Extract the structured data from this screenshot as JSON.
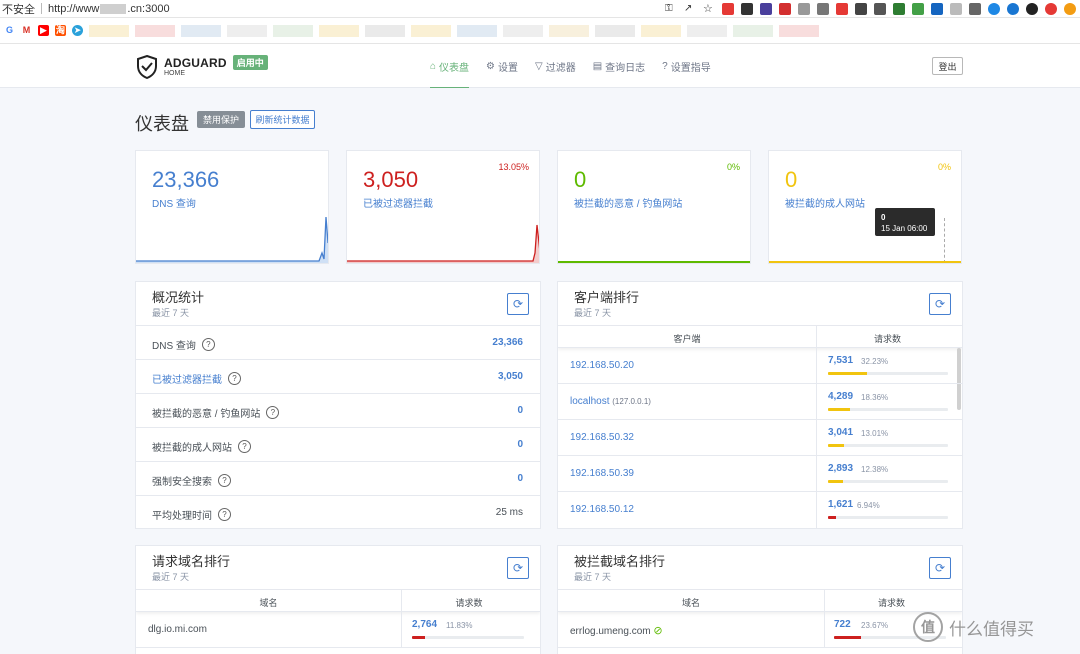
{
  "browser": {
    "insecure_label": "不安全",
    "url_prefix": "http://www",
    "url_suffix": ".cn:3000"
  },
  "header": {
    "logo_title": "ADGUARD",
    "logo_subtitle": "HOME",
    "status_badge": "启用中",
    "nav": [
      "仪表盘",
      "设置",
      "过滤器",
      "查询日志",
      "设置指导"
    ],
    "logout": "登出"
  },
  "page": {
    "title": "仪表盘",
    "disable_btn": "禁用保护",
    "refresh_btn": "刷新统计数据"
  },
  "cards": [
    {
      "value": "23,366",
      "label": "DNS 查询",
      "pct": "",
      "color": "#467fcf"
    },
    {
      "value": "3,050",
      "label": "已被过滤器拦截",
      "pct": "13.05%",
      "color": "#cd201f"
    },
    {
      "value": "0",
      "label": "被拦截的恶意 / 钓鱼网站",
      "pct": "0%",
      "color": "#5eba00"
    },
    {
      "value": "0",
      "label": "被拦截的成人网站",
      "pct": "0%",
      "color": "#f1c40f"
    }
  ],
  "tooltip": {
    "value": "0",
    "date": "15 Jan 06:00"
  },
  "general": {
    "title": "概况统计",
    "sub": "最近 7 天",
    "rows": [
      {
        "label": "DNS 查询",
        "value": "23,366"
      },
      {
        "label": "已被过滤器拦截",
        "value": "3,050"
      },
      {
        "label": "被拦截的恶意 / 钓鱼网站",
        "value": "0"
      },
      {
        "label": "被拦截的成人网站",
        "value": "0"
      },
      {
        "label": "强制安全搜索",
        "value": "0"
      },
      {
        "label": "平均处理时间",
        "value": "25 ms"
      }
    ]
  },
  "clients": {
    "title": "客户端排行",
    "sub": "最近 7 天",
    "col1": "客户端",
    "col2": "请求数",
    "rows": [
      {
        "name": "192.168.50.20",
        "sub": "",
        "count": "7,531",
        "pct": "32.23%",
        "ratio": 0.3223,
        "color": "#f1c40f"
      },
      {
        "name": "localhost",
        "sub": "(127.0.0.1)",
        "count": "4,289",
        "pct": "18.36%",
        "ratio": 0.1836,
        "color": "#f1c40f"
      },
      {
        "name": "192.168.50.32",
        "sub": "",
        "count": "3,041",
        "pct": "13.01%",
        "ratio": 0.1301,
        "color": "#f1c40f"
      },
      {
        "name": "192.168.50.39",
        "sub": "",
        "count": "2,893",
        "pct": "12.38%",
        "ratio": 0.1238,
        "color": "#f1c40f"
      },
      {
        "name": "192.168.50.12",
        "sub": "",
        "count": "1,621",
        "pct": "6.94%",
        "ratio": 0.0694,
        "color": "#cd201f"
      }
    ]
  },
  "domains": {
    "title": "请求域名排行",
    "sub": "最近 7 天",
    "col1": "域名",
    "col2": "请求数",
    "rows": [
      {
        "name": "dlg.io.mi.com",
        "count": "2,764",
        "pct": "11.83%",
        "ratio": 0.1183,
        "color": "#cd201f"
      }
    ]
  },
  "blocked": {
    "title": "被拦截域名排行",
    "sub": "最近 7 天",
    "col1": "域名",
    "col2": "请求数",
    "rows": [
      {
        "name": "errlog.umeng.com",
        "count": "722",
        "pct": "23.67%",
        "ratio": 0.2367,
        "color": "#cd201f"
      }
    ]
  },
  "watermark": "什么值得买"
}
